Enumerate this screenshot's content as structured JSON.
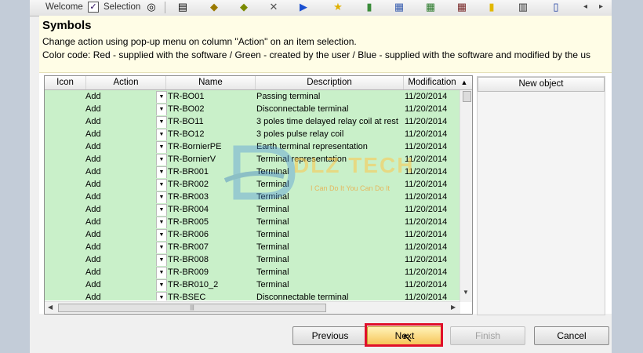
{
  "toolbar": {
    "welcome_label": "Welcome",
    "selection_label": "Selection",
    "selection_checked": "✓",
    "nav_prev": "◂",
    "nav_next": "▸"
  },
  "panel": {
    "title": "Symbols",
    "info_line1": "Change action using pop-up menu on column \"Action\" on an item selection.",
    "info_line2": "Color code: Red - supplied with the software / Green - created by the user / Blue - supplied with the software and modified by the us"
  },
  "grid": {
    "columns": [
      "Icon",
      "Action",
      "Name",
      "Description",
      "Modification"
    ],
    "rows": [
      {
        "action": "Add",
        "name": "TR-BO01",
        "description": "Passing terminal",
        "date": "11/20/2014"
      },
      {
        "action": "Add",
        "name": "TR-BO02",
        "description": "Disconnectable terminal",
        "date": "11/20/2014"
      },
      {
        "action": "Add",
        "name": "TR-BO11",
        "description": "3 poles time delayed relay coil at rest",
        "date": "11/20/2014"
      },
      {
        "action": "Add",
        "name": "TR-BO12",
        "description": "3 poles pulse relay coil",
        "date": "11/20/2014"
      },
      {
        "action": "Add",
        "name": "TR-BornierPE",
        "description": "Earth terminal representation",
        "date": "11/20/2014"
      },
      {
        "action": "Add",
        "name": "TR-BornierV",
        "description": "Terminal representation",
        "date": "11/20/2014"
      },
      {
        "action": "Add",
        "name": "TR-BR001",
        "description": "Terminal",
        "date": "11/20/2014"
      },
      {
        "action": "Add",
        "name": "TR-BR002",
        "description": "Terminal",
        "date": "11/20/2014"
      },
      {
        "action": "Add",
        "name": "TR-BR003",
        "description": "Terminal",
        "date": "11/20/2014"
      },
      {
        "action": "Add",
        "name": "TR-BR004",
        "description": "Terminal",
        "date": "11/20/2014"
      },
      {
        "action": "Add",
        "name": "TR-BR005",
        "description": "Terminal",
        "date": "11/20/2014"
      },
      {
        "action": "Add",
        "name": "TR-BR006",
        "description": "Terminal",
        "date": "11/20/2014"
      },
      {
        "action": "Add",
        "name": "TR-BR007",
        "description": "Terminal",
        "date": "11/20/2014"
      },
      {
        "action": "Add",
        "name": "TR-BR008",
        "description": "Terminal",
        "date": "11/20/2014"
      },
      {
        "action": "Add",
        "name": "TR-BR009",
        "description": "Terminal",
        "date": "11/20/2014"
      },
      {
        "action": "Add",
        "name": "TR-BR010_2",
        "description": "Terminal",
        "date": "11/20/2014"
      },
      {
        "action": "Add",
        "name": "TR-BSEC",
        "description": "Disconnectable terminal",
        "date": "11/20/2014"
      }
    ],
    "row_color": "#c9f0c9"
  },
  "side": {
    "new_object_label": "New object"
  },
  "buttons": {
    "previous": "Previous",
    "next": "Next",
    "finish": "Finish",
    "cancel": "Cancel"
  },
  "watermark": {
    "brand": "DLZ TECH",
    "tagline": "I Can Do It You Can Do It"
  },
  "colors": {
    "highlight_box": "#e0102a",
    "next_button": "#f6c55a"
  }
}
